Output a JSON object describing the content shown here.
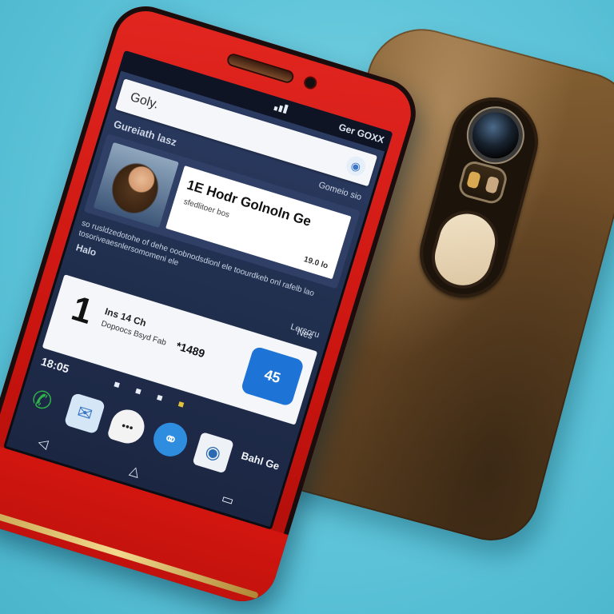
{
  "status_bar": {
    "carrier": "Ger GOXX"
  },
  "search": {
    "text": "Goly."
  },
  "feed": {
    "header": "Gureiath lasz",
    "header_right": "Gomeio sio",
    "card": {
      "title": "1E Hodr Golnoln Ge",
      "subtitle": "sfedlitoer bos",
      "meta": "19.0 lo"
    },
    "body": "so rusldzedotohe of dehe ooobnodsdionl ele toourdkeb onl rafelb lao tosoriveaesnlersomomeni ele",
    "side_label": "Halo",
    "link": "Lersoru"
  },
  "widget": {
    "more": "Nes",
    "number": "1",
    "line1": "Ins 14 Ch",
    "line2": "Dopoocs Bsyd Fab",
    "price": "*1489",
    "badge": "45"
  },
  "home": {
    "time": "18:05",
    "dock_label": "Bahl Ge"
  },
  "icons": {
    "phone": "phone-icon",
    "messages": "messages-icon",
    "chat": "chat-icon",
    "browser": "browser-icon",
    "camera": "camera-icon",
    "back": "back-icon",
    "home": "home-icon",
    "recent": "recent-apps-icon"
  },
  "colors": {
    "phone_red": "#d21a14",
    "cover_brown": "#6b4a26",
    "background_cyan": "#5ec4d9",
    "screen_navy": "#24335a",
    "accent_blue": "#1e74d6"
  }
}
